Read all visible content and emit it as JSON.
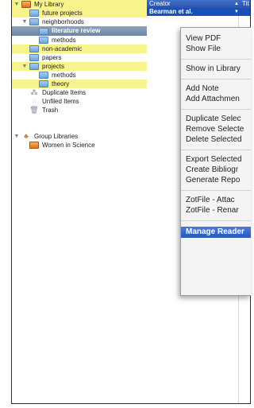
{
  "sidebar": {
    "my_library": "My Library",
    "future_projects": "future projects",
    "neighborhoods": "neighborhoods",
    "literature_review": "literature review",
    "methods_1": "methods",
    "non_academic": "non-academic",
    "papers": "papers",
    "projects": "projects",
    "methods_2": "methods",
    "theory": "theory",
    "duplicate_items": "Duplicate Items",
    "unfiled_items": "Unfiled Items",
    "trash": "Trash",
    "group_libraries": "Group Libraries",
    "women_in_science": "Women in Science",
    "highlight_color": "#f8f48c",
    "selected_color": "#7f95b3"
  },
  "columns": {
    "creator": "Creator",
    "title_partial": "Tit"
  },
  "selected_row": {
    "creator": "Bearman et al."
  },
  "context_menu": {
    "view_pdf": "View PDF",
    "show_file": "Show File",
    "show_in_library": "Show in Library",
    "add_note": "Add Note",
    "add_attachment": "Add Attachmen",
    "duplicate_selected": "Duplicate Selec",
    "remove_selected": "Remove Selecte",
    "delete_selected": "Delete Selected",
    "export_selected": "Export Selected",
    "create_bibliography": "Create Bibliogr",
    "generate_report": "Generate Repo",
    "zotfile_attach": "ZotFile - Attac",
    "zotfile_rename": "ZotFile - Renar",
    "manage_reader": "Manage Reader",
    "active_color": "#2858bd"
  }
}
